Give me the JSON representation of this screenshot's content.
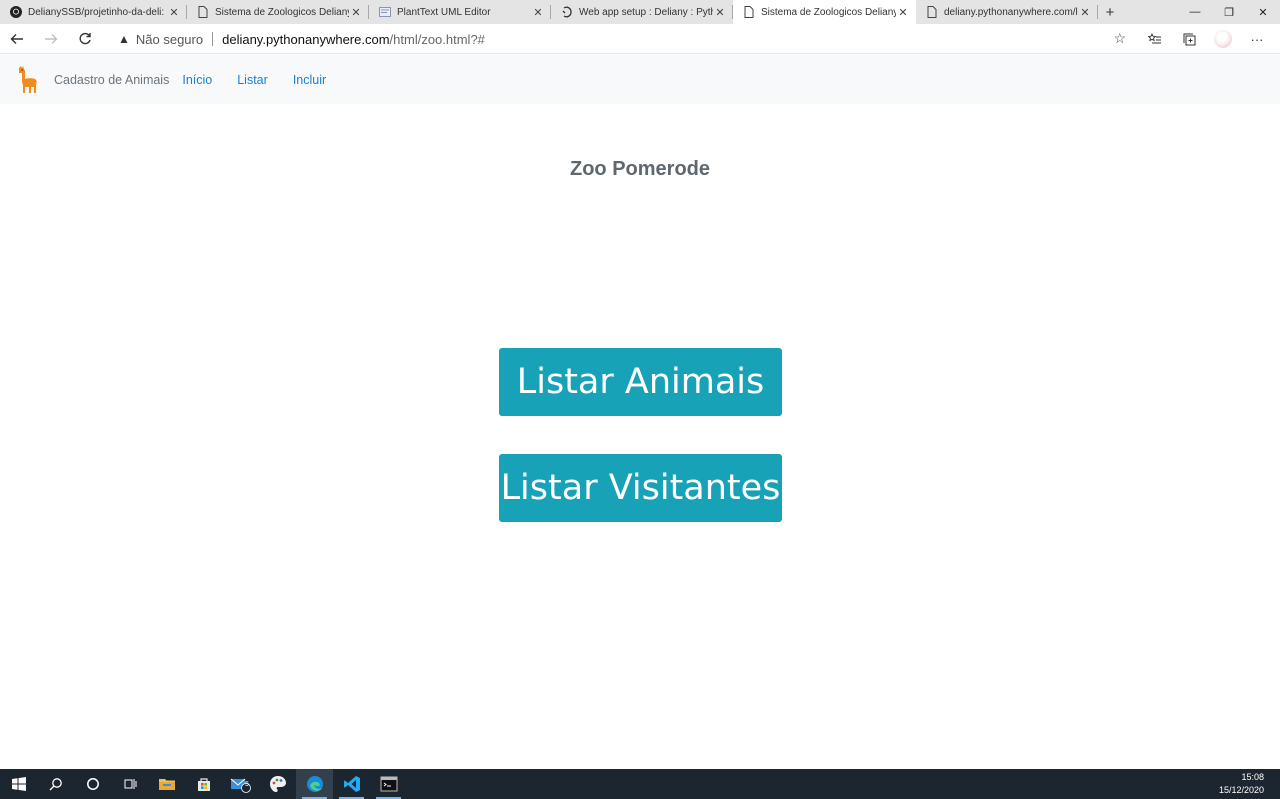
{
  "browser": {
    "tabs": [
      {
        "title": "DelianySSB/projetinho-da-deli: S",
        "icon": "github-icon",
        "active": false
      },
      {
        "title": "Sistema de Zoologicos Deliany",
        "icon": "page-icon",
        "active": false
      },
      {
        "title": "PlantText UML Editor",
        "icon": "planttext-icon",
        "active": false
      },
      {
        "title": "Web app setup : Deliany : Pythor",
        "icon": "pythonanywhere-icon",
        "active": false
      },
      {
        "title": "Sistema de Zoologicos Deliany",
        "icon": "page-icon",
        "active": true
      },
      {
        "title": "deliany.pythonanywhere.com/lis",
        "icon": "page-icon",
        "active": false
      }
    ],
    "security_label": "Não seguro",
    "url_host": "deliany.pythonanywhere.com",
    "url_path": "/html/zoo.html?#"
  },
  "site": {
    "brand": "Cadastro de Animais",
    "nav_links": [
      "Início",
      "Listar",
      "Incluir"
    ],
    "heading": "Zoo Pomerode",
    "buttons": {
      "animais": "Listar Animais",
      "visitantes": "Listar Visitantes"
    },
    "colors": {
      "button": "#17a2b8",
      "link": "#1a7fd4",
      "navbar_bg": "#f8f9fa"
    }
  },
  "taskbar": {
    "mail_badge": "5",
    "time": "15:08",
    "date": "15/12/2020"
  }
}
